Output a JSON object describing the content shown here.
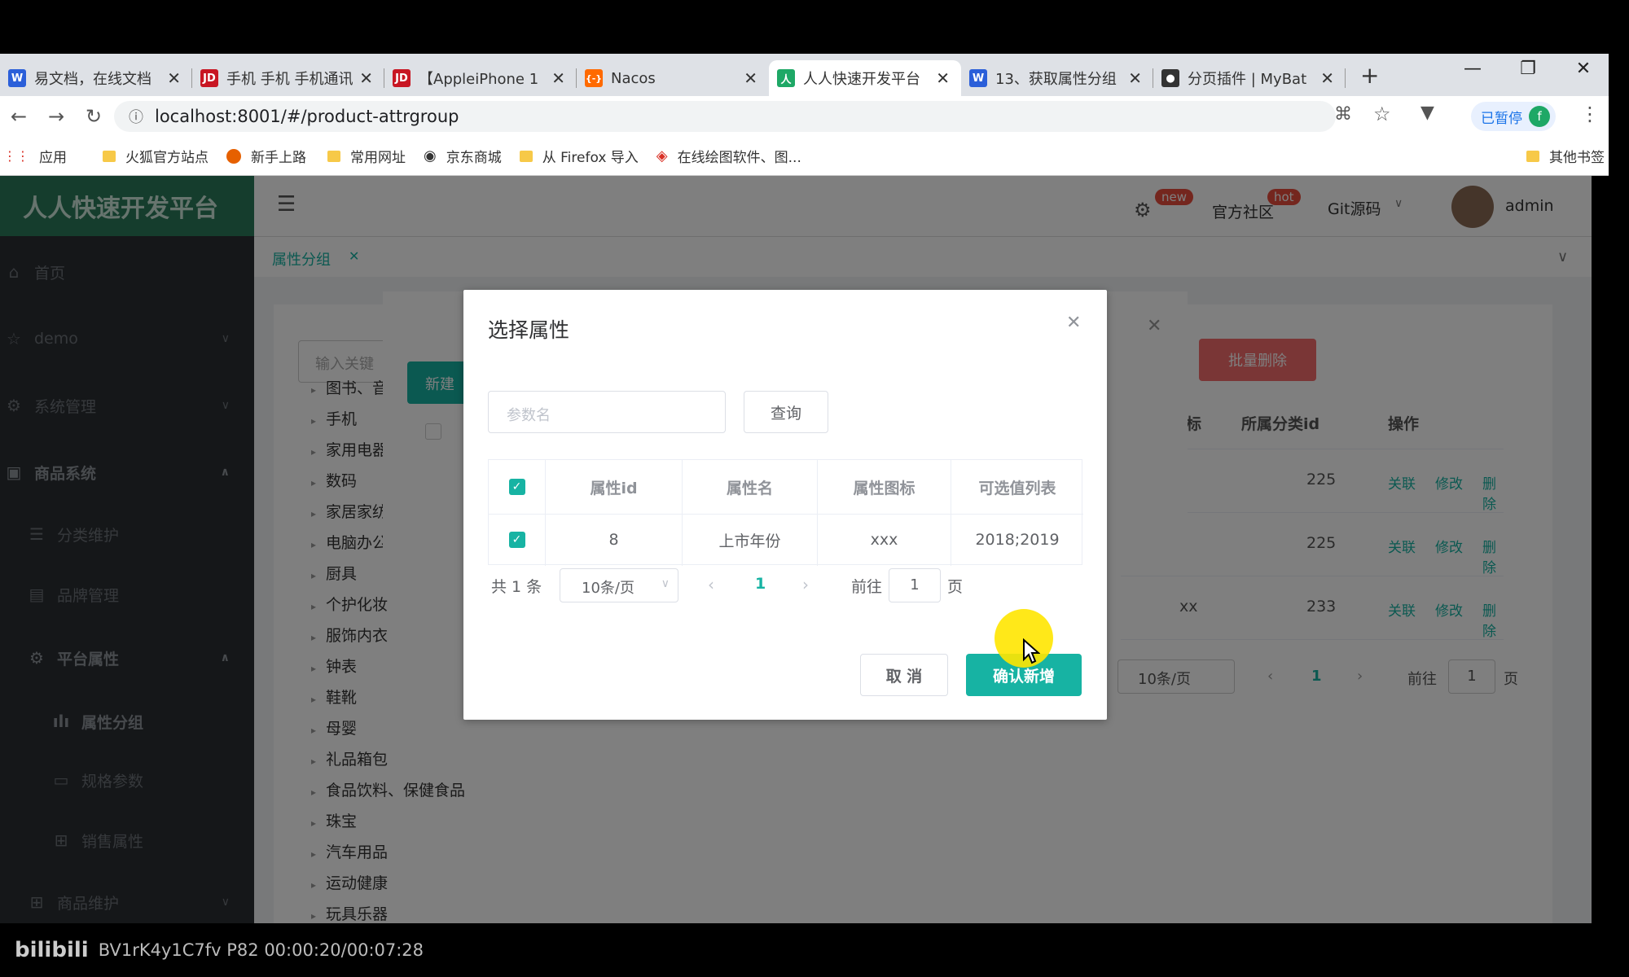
{
  "browser": {
    "tabs": [
      {
        "label": "易文档，在线文档",
        "fav": "W",
        "color": "#2b5fd9"
      },
      {
        "label": "手机 手机 手机通讯",
        "fav": "JD",
        "color": "#c81623"
      },
      {
        "label": "【AppleiPhone 1",
        "fav": "JD",
        "color": "#c81623"
      },
      {
        "label": "Nacos",
        "fav": "{-}",
        "color": "#ff6a00"
      },
      {
        "label": "人人快速开发平台",
        "fav": "人",
        "color": "#1ea866"
      },
      {
        "label": "13、获取属性分组",
        "fav": "W",
        "color": "#2b5fd9"
      },
      {
        "label": "分页插件 | MyBat",
        "fav": "🐦",
        "color": "#333333"
      }
    ],
    "url": "localhost:8001/#/product-attrgroup",
    "paused_label": "已暂停",
    "profile_initial": "f",
    "bookmarks": [
      "应用",
      "火狐官方站点",
      "新手上路",
      "常用网址",
      "京东商城",
      "从 Firefox 导入",
      "在线绘图软件、图...",
      "其他书签"
    ]
  },
  "app": {
    "logo": "人人快速开发平台",
    "menu": [
      {
        "label": "首页",
        "icon": "home-icon"
      },
      {
        "label": "demo",
        "icon": "star-icon"
      },
      {
        "label": "系统管理",
        "icon": "gear-icon"
      },
      {
        "label": "商品系统",
        "icon": "box-icon"
      },
      {
        "label": "分类维护",
        "icon": "list-icon"
      },
      {
        "label": "品牌管理",
        "icon": "brand-icon"
      },
      {
        "label": "平台属性",
        "icon": "gear-icon"
      },
      {
        "label": "属性分组",
        "icon": "chart-icon"
      },
      {
        "label": "规格参数",
        "icon": "doc-icon"
      },
      {
        "label": "销售属性",
        "icon": "grid-icon"
      },
      {
        "label": "商品维护",
        "icon": "grid-icon"
      }
    ],
    "topbar": {
      "new_badge": "new",
      "community": "官方社区",
      "hot_badge": "hot",
      "git": "Git源码",
      "user": "admin"
    },
    "page_tab": "属性分组",
    "search_placeholder": "输入关键",
    "tree": [
      "图书、音",
      "手机",
      "家用电器",
      "数码",
      "家居家纺",
      "电脑办公",
      "厨具",
      "个护化妆",
      "服饰内衣",
      "钟表",
      "鞋靴",
      "母婴",
      "礼品箱包",
      "食品饮料、保健食品",
      "珠宝",
      "汽车用品",
      "运动健康",
      "玩具乐器"
    ],
    "new_btn": "新建",
    "batch_delete": "批量删除",
    "bg_table": {
      "headers": [
        "标",
        "所属分类id",
        "操作"
      ],
      "rows": [
        {
          "icon": "",
          "cat": "225"
        },
        {
          "icon": "",
          "cat": "225"
        },
        {
          "icon": "xx",
          "cat": "233"
        }
      ],
      "actions": [
        "关联",
        "修改",
        "删除"
      ],
      "pagesize": "10条/页",
      "page": "1",
      "goto": "前往",
      "goto_val": "1",
      "page_suffix": "页"
    }
  },
  "dialog": {
    "title": "选择属性",
    "param_placeholder": "参数名",
    "query": "查询",
    "headers": [
      "属性id",
      "属性名",
      "属性图标",
      "可选值列表"
    ],
    "rows": [
      {
        "id": "8",
        "name": "上市年份",
        "icon": "xxx",
        "values": "2018;2019"
      }
    ],
    "total": "共 1 条",
    "pagesize": "10条/页",
    "page": "1",
    "goto": "前往",
    "goto_val": "1",
    "page_suffix": "页",
    "cancel": "取 消",
    "confirm": "确认新增"
  },
  "footer": {
    "watermark": "BV1rK4y1C7fv P82 00:00:20/00:07:28",
    "logo": "bilibili"
  }
}
